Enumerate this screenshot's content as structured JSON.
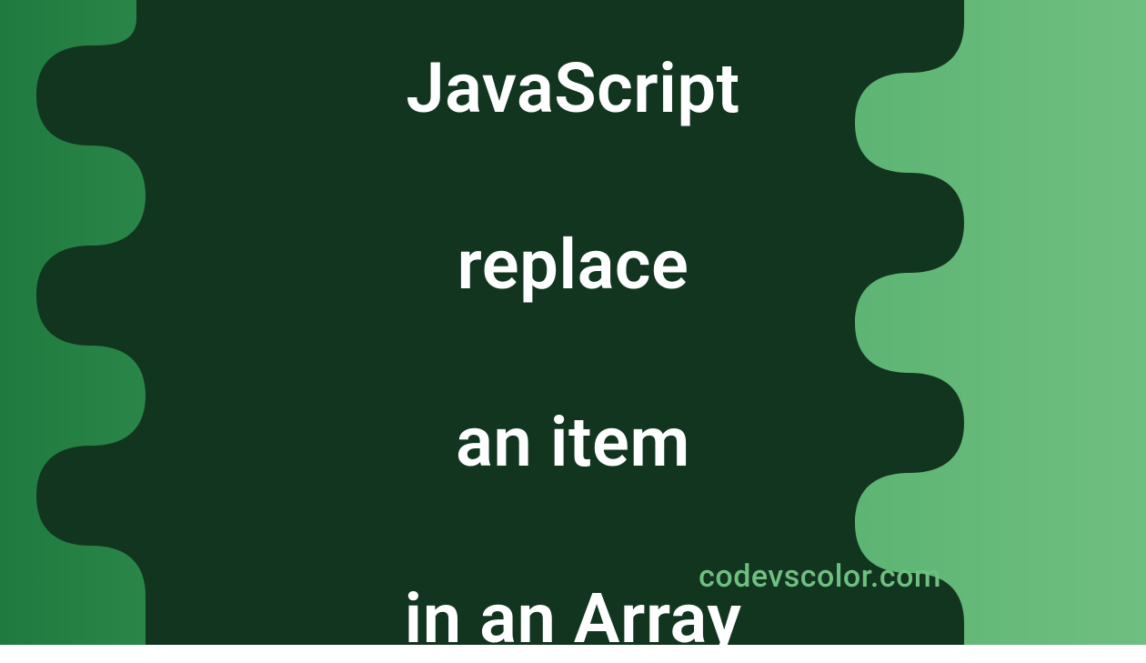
{
  "banner": {
    "title_line1": "JavaScript",
    "title_line2": "replace",
    "title_line3": "an item",
    "title_line4": "in an Array",
    "site": "codevscolor.com"
  },
  "colors": {
    "blob": "#12351f",
    "gradient_left": "#1f7a3f",
    "gradient_right": "#6fbf80",
    "text": "#ffffff",
    "site_text": "#6fbf80"
  }
}
